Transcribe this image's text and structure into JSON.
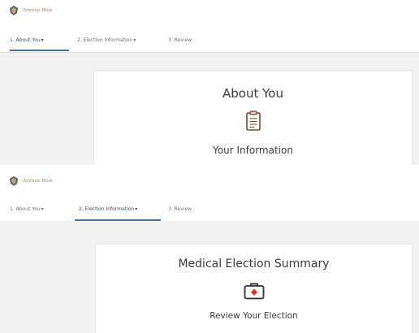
{
  "screens": [
    {
      "brand": "Avenue Blue",
      "tabs": [
        {
          "label": "1. About You",
          "caret": "▾",
          "active": true
        },
        {
          "label": "2. Election Information",
          "caret": "▾",
          "active": false
        },
        {
          "label": "3. Review",
          "caret": "",
          "active": false
        }
      ],
      "card": {
        "title": "About You",
        "icon": "clipboard-icon",
        "subtitle": "Your Information"
      }
    },
    {
      "brand": "Avenue Blue",
      "tabs": [
        {
          "label": "1. About You",
          "caret": "▾",
          "active": false
        },
        {
          "label": "2. Election Information",
          "caret": "▾",
          "active": true
        },
        {
          "label": "3. Review",
          "caret": "",
          "active": false
        }
      ],
      "card": {
        "title": "Medical Election Summary",
        "icon": "medical-kit-icon",
        "subtitle": "Review Your Election"
      }
    }
  ],
  "colors": {
    "accent": "#4a6fb5",
    "brand": "#8c7a52",
    "content_bg": "#f2f2f2",
    "medical_red": "#d8322f"
  }
}
